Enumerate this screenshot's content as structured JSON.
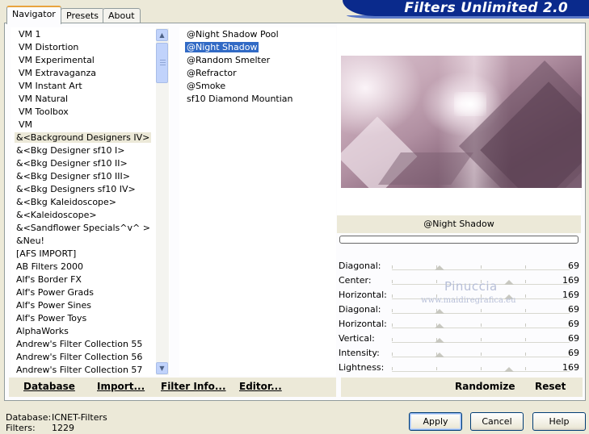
{
  "banner": {
    "title": "Filters Unlimited 2.0"
  },
  "tabs": [
    {
      "label": "Navigator"
    },
    {
      "label": "Presets"
    },
    {
      "label": "About"
    }
  ],
  "categories": [
    "VM 1",
    "VM Distortion",
    "VM Experimental",
    "VM Extravaganza",
    "VM Instant Art",
    "VM Natural",
    "VM Toolbox",
    "VM",
    "&<Background Designers IV>",
    "&<Bkg Designer sf10 I>",
    "&<Bkg Designer sf10 II>",
    "&<Bkg Designer sf10 III>",
    "&<Bkg Designers sf10 IV>",
    "&<Bkg Kaleidoscope>",
    "&<Kaleidoscope>",
    "&<Sandflower Specials^v^ >",
    "&Neu!",
    "[AFS IMPORT]",
    "AB Filters 2000",
    "Alf's Border FX",
    "Alf's Power Grads",
    "Alf's Power Sines",
    "Alf's Power Toys",
    "AlphaWorks",
    "Andrew's Filter Collection 55",
    "Andrew's Filter Collection 56",
    "Andrew's Filter Collection 57"
  ],
  "selected_category": "&<Background Designers IV>",
  "filters": [
    "@Night Shadow Pool",
    "@Night Shadow",
    "@Random Smelter",
    "@Refractor",
    "@Smoke",
    "sf10 Diamond Mountian"
  ],
  "selected_filter": "@Night Shadow",
  "links": {
    "database": "Database",
    "import": "Import...",
    "filter_info": "Filter Info...",
    "editor": "Editor...",
    "randomize": "Randomize",
    "reset": "Reset"
  },
  "preview": {
    "filter_name": "@Night Shadow",
    "progress": 0
  },
  "params": [
    {
      "label": "Diagonal:",
      "value": "69",
      "level": 0.27
    },
    {
      "label": "Center:",
      "value": "169",
      "level": 0.66
    },
    {
      "label": "Horizontal:",
      "value": "169",
      "level": 0.66
    },
    {
      "label": "Diagonal:",
      "value": "69",
      "level": 0.27
    },
    {
      "label": "Horizontal:",
      "value": "69",
      "level": 0.27
    },
    {
      "label": "Vertical:",
      "value": "69",
      "level": 0.27
    },
    {
      "label": "Intensity:",
      "value": "69",
      "level": 0.27
    },
    {
      "label": "Lightness:",
      "value": "169",
      "level": 0.66
    }
  ],
  "watermark": {
    "name": "Pinuccia",
    "site": "www.maidiregrafica.eu"
  },
  "buttons": {
    "apply": "Apply",
    "cancel": "Cancel",
    "help": "Help"
  },
  "status": {
    "database_label": "Database:",
    "database_value": "ICNET-Filters",
    "filters_label": "Filters:",
    "filters_value": "1229"
  }
}
